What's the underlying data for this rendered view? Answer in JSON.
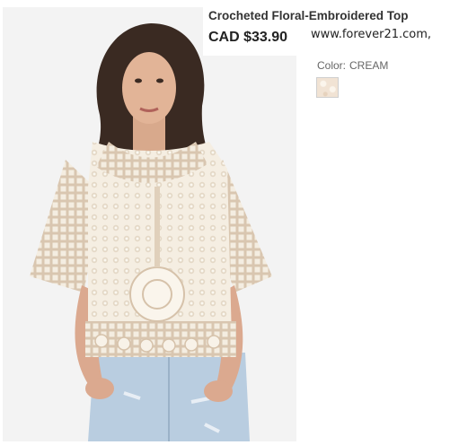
{
  "product": {
    "title": "Crocheted Floral-Embroidered Top",
    "price": "CAD $33.90",
    "source": "www.forever21.com,"
  },
  "color": {
    "label": "Color:",
    "value": "CREAM",
    "swatch_hex": "#f1e3d4"
  },
  "icons": [
    "product-photo"
  ]
}
